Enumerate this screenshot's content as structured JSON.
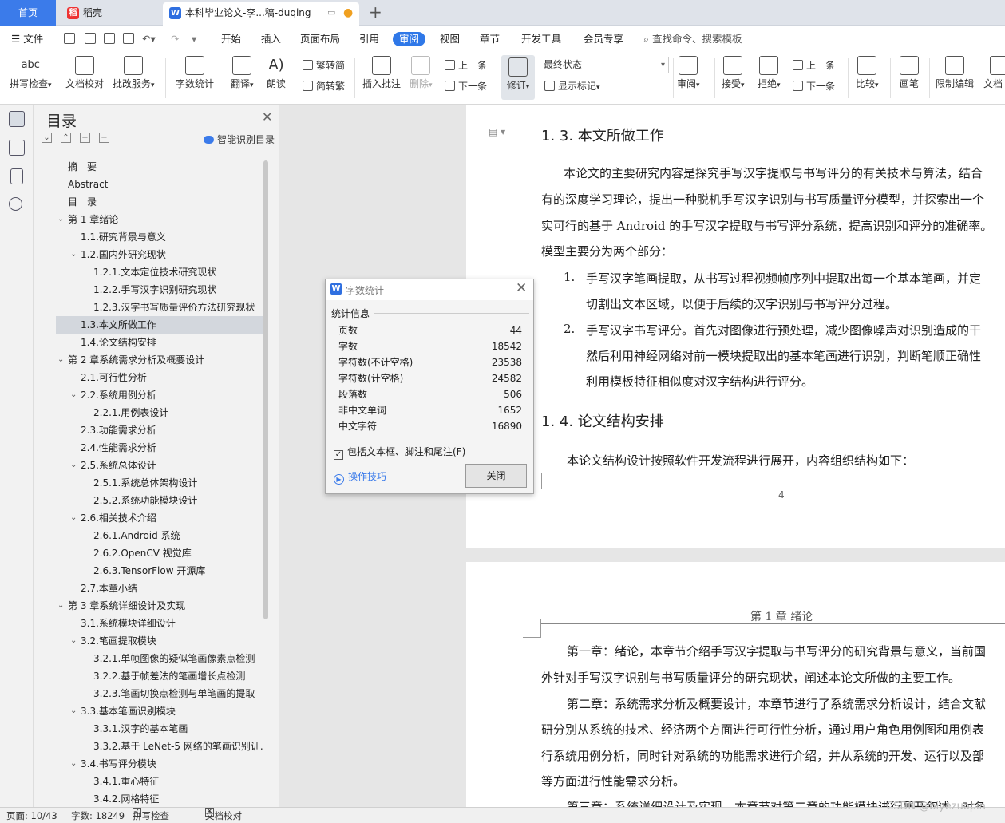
{
  "tabs": {
    "home": "首页",
    "daoke": "稻壳",
    "doc": "本科毕业论文-李...稿-duqing",
    "new": "+"
  },
  "menu": {
    "file": "文件",
    "items": [
      "开始",
      "插入",
      "页面布局",
      "引用",
      "审阅",
      "视图",
      "章节",
      "开发工具",
      "会员专享"
    ],
    "active": "审阅",
    "search": "查找命令、搜索模板"
  },
  "toolbar": {
    "spell": "拼写检查",
    "proof": "文档校对",
    "batch": "批改服务",
    "wordcount": "字数统计",
    "translate": "翻译",
    "read": "朗读",
    "trad": "繁转简",
    "simp": "简转繁",
    "insert_comment": "插入批注",
    "delete": "删除",
    "prev_comment": "上一条",
    "next_comment": "下一条",
    "revise": "修订",
    "final_state": "最终状态",
    "show_marks": "显示标记",
    "review": "审阅",
    "accept": "接受",
    "reject": "拒绝",
    "prev": "上一条",
    "next": "下一条",
    "compare": "比较",
    "pen": "画笔",
    "restrict": "限制编辑",
    "doc_more": "文档"
  },
  "toc": {
    "title": "目录",
    "smart": "智能识别目录",
    "items": [
      {
        "label": "摘　要",
        "level": 0,
        "chev": ""
      },
      {
        "label": "Abstract",
        "level": 0,
        "chev": ""
      },
      {
        "label": "目　录",
        "level": 0,
        "chev": ""
      },
      {
        "label": "第 1 章绪论",
        "level": 0,
        "chev": "v"
      },
      {
        "label": "1.1.研究背景与意义",
        "level": 1,
        "chev": ""
      },
      {
        "label": "1.2.国内外研究现状",
        "level": 1,
        "chev": "v"
      },
      {
        "label": "1.2.1.文本定位技术研究现状",
        "level": 2,
        "chev": ""
      },
      {
        "label": "1.2.2.手写汉字识别研究现状",
        "level": 2,
        "chev": ""
      },
      {
        "label": "1.2.3.汉字书写质量评价方法研究现状",
        "level": 2,
        "chev": ""
      },
      {
        "label": "1.3.本文所做工作",
        "level": 1,
        "chev": "",
        "selected": true
      },
      {
        "label": "1.4.论文结构安排",
        "level": 1,
        "chev": ""
      },
      {
        "label": "第 2 章系统需求分析及概要设计",
        "level": 0,
        "chev": "v"
      },
      {
        "label": "2.1.可行性分析",
        "level": 1,
        "chev": ""
      },
      {
        "label": "2.2.系统用例分析",
        "level": 1,
        "chev": "v"
      },
      {
        "label": "2.2.1.用例表设计",
        "level": 2,
        "chev": ""
      },
      {
        "label": "2.3.功能需求分析",
        "level": 1,
        "chev": ""
      },
      {
        "label": "2.4.性能需求分析",
        "level": 1,
        "chev": ""
      },
      {
        "label": "2.5.系统总体设计",
        "level": 1,
        "chev": "v"
      },
      {
        "label": "2.5.1.系统总体架构设计",
        "level": 2,
        "chev": ""
      },
      {
        "label": "2.5.2.系统功能模块设计",
        "level": 2,
        "chev": ""
      },
      {
        "label": "2.6.相关技术介绍",
        "level": 1,
        "chev": "v"
      },
      {
        "label": "2.6.1.Android 系统",
        "level": 2,
        "chev": ""
      },
      {
        "label": "2.6.2.OpenCV 视觉库",
        "level": 2,
        "chev": ""
      },
      {
        "label": "2.6.3.TensorFlow 开源库",
        "level": 2,
        "chev": ""
      },
      {
        "label": "2.7.本章小结",
        "level": 1,
        "chev": ""
      },
      {
        "label": "第 3 章系统详细设计及实现",
        "level": 0,
        "chev": "v"
      },
      {
        "label": "3.1.系统模块详细设计",
        "level": 1,
        "chev": ""
      },
      {
        "label": "3.2.笔画提取模块",
        "level": 1,
        "chev": "v"
      },
      {
        "label": "3.2.1.单帧图像的疑似笔画像素点检测",
        "level": 2,
        "chev": ""
      },
      {
        "label": "3.2.2.基于帧差法的笔画增长点检测",
        "level": 2,
        "chev": ""
      },
      {
        "label": "3.2.3.笔画切换点检测与单笔画的提取",
        "level": 2,
        "chev": ""
      },
      {
        "label": "3.3.基本笔画识别模块",
        "level": 1,
        "chev": "v"
      },
      {
        "label": "3.3.1.汉字的基本笔画",
        "level": 2,
        "chev": ""
      },
      {
        "label": "3.3.2.基于 LeNet-5 网络的笔画识别训...",
        "level": 2,
        "chev": ""
      },
      {
        "label": "3.4.书写评分模块",
        "level": 1,
        "chev": "v"
      },
      {
        "label": "3.4.1.重心特征",
        "level": 2,
        "chev": ""
      },
      {
        "label": "3.4.2.网格特征",
        "level": 2,
        "chev": ""
      }
    ]
  },
  "document": {
    "h13": "1. 3.  本文所做工作",
    "p1": [
      "本论文的主要研究内容是探究手写汉字提取与书写评分的有关技术与算法，结合",
      "有的深度学习理论，提出一种脱机手写汉字识别与书写质量评分模型，并探索出一个",
      "实可行的基于 Android 的手写汉字提取与书写评分系统，提高识别和评分的准确率。",
      "模型主要分为两个部分："
    ],
    "li1_num": "1.",
    "li1": [
      "手写汉字笔画提取，从书写过程视频帧序列中提取出每一个基本笔画，并定",
      "切割出文本区域，以便于后续的汉字识别与书写评分过程。"
    ],
    "li2_num": "2.",
    "li2": [
      "手写汉字书写评分。首先对图像进行预处理，减少图像噪声对识别造成的干",
      "然后利用神经网络对前一模块提取出的基本笔画进行识别，判断笔顺正确性",
      "利用模板特征相似度对汉字结构进行评分。"
    ],
    "h14": "1. 4.  论文结构安排",
    "p2": "本论文结构设计按照软件开发流程进行展开，内容组织结构如下：",
    "page_number": "4",
    "header": "第 1 章  绪论",
    "p3": [
      "第一章：绪论，本章节介绍手写汉字提取与书写评分的研究背景与意义，当前国",
      "外针对手写汉字识别与书写质量评分的研究现状，阐述本论文所做的主要工作。",
      "第二章：系统需求分析及概要设计，本章节进行了系统需求分析设计，结合文献",
      "研分别从系统的技术、经济两个方面进行可行性分析，通过用户角色用例图和用例表",
      "行系统用例分析，同时针对系统的功能需求进行介绍，并从系统的开发、运行以及部",
      "等方面进行性能需求分析。",
      "第三章：系统详细设计及实现，本章节对第二章的功能模块进行展开叙述，对各"
    ]
  },
  "dialog": {
    "title": "字数统计",
    "section": "统计信息",
    "stats": [
      {
        "label": "页数",
        "value": "44"
      },
      {
        "label": "字数",
        "value": "18542"
      },
      {
        "label": "字符数(不计空格)",
        "value": "23538"
      },
      {
        "label": "字符数(计空格)",
        "value": "24582"
      },
      {
        "label": "段落数",
        "value": "506"
      },
      {
        "label": "非中文单词",
        "value": "1652"
      },
      {
        "label": "中文字符",
        "value": "16890"
      }
    ],
    "include_label": "包括文本框、脚注和尾注(F)",
    "include_checked": true,
    "tips": "操作技巧",
    "close": "关闭"
  },
  "statusbar": {
    "page": "页面: 10/43",
    "words": "字数: 18249",
    "spell": "拼写检查",
    "proof": "文档校对"
  },
  "watermark": "CSDN @biyezuopin",
  "colors": {
    "accent": "#2f78e8",
    "tab_home": "#3b7bea",
    "selected": "#d3d7dd"
  }
}
